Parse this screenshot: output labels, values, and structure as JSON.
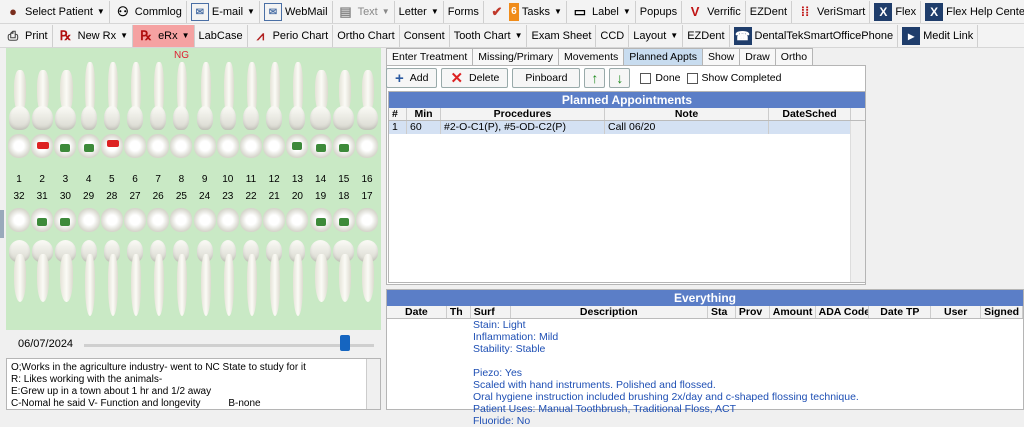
{
  "toolbar1": [
    {
      "label": "Select Patient",
      "icon": "patient-icon",
      "dropdown": true
    },
    {
      "label": "Commlog",
      "icon": "commlog-icon"
    },
    {
      "label": "E-mail",
      "icon": "email-icon",
      "dropdown": true
    },
    {
      "label": "WebMail",
      "icon": "webmail-icon"
    },
    {
      "label": "Text",
      "icon": "text-message-icon",
      "dropdown": true,
      "disabled": true
    },
    {
      "label": "Letter",
      "dropdown": true
    },
    {
      "label": "Forms"
    },
    {
      "label": "Tasks",
      "icon": "tasks-icon",
      "badge": "6",
      "dropdown": true
    },
    {
      "label": "Label",
      "icon": "label-icon",
      "dropdown": true
    },
    {
      "label": "Popups"
    },
    {
      "label": "Verrific",
      "icon": "verrific-icon"
    },
    {
      "label": "EZDent"
    },
    {
      "label": "VeriSmart",
      "icon": "verismart-icon"
    },
    {
      "label": "Flex",
      "icon": "flex-icon"
    },
    {
      "label": "Flex Help Center",
      "icon": "flex-help-icon"
    }
  ],
  "toolbar2": [
    {
      "label": "Print",
      "icon": "print-icon"
    },
    {
      "label": "New Rx",
      "icon": "rx-icon",
      "dropdown": true
    },
    {
      "label": "eRx",
      "icon": "erx-icon",
      "dropdown": true,
      "highlight": true
    },
    {
      "label": "LabCase"
    },
    {
      "label": "Perio Chart",
      "icon": "perio-chart-icon"
    },
    {
      "label": "Ortho Chart"
    },
    {
      "label": "Consent"
    },
    {
      "label": "Tooth Chart",
      "dropdown": true
    },
    {
      "label": "Exam Sheet"
    },
    {
      "label": "CCD"
    },
    {
      "label": "Layout",
      "dropdown": true
    },
    {
      "label": "EZDent"
    },
    {
      "label": "DentalTekSmartOfficePhone",
      "icon": "phone-icon"
    },
    {
      "label": "Medit Link",
      "icon": "medit-link-icon"
    }
  ],
  "chart": {
    "ng_label": "NG",
    "upper_numbers": [
      "1",
      "2",
      "3",
      "4",
      "5",
      "6",
      "7",
      "8",
      "9",
      "10",
      "11",
      "12",
      "13",
      "14",
      "15",
      "16"
    ],
    "lower_numbers": [
      "32",
      "31",
      "30",
      "29",
      "28",
      "27",
      "26",
      "25",
      "24",
      "23",
      "22",
      "21",
      "20",
      "19",
      "18",
      "17"
    ]
  },
  "date": {
    "label": "06/07/2024",
    "slider_value": 0.9
  },
  "notes": [
    "O;Works in the agriculture industry- went to NC State to study for it",
    "R: Likes working with the animals-",
    "E:Grew up in a town about 1 hr and 1/2 away",
    "C-Nomal he said V- Function and longevity          B-none"
  ],
  "tabs": [
    {
      "label": "Enter Treatment"
    },
    {
      "label": "Missing/Primary"
    },
    {
      "label": "Movements"
    },
    {
      "label": "Planned Appts",
      "active": true
    },
    {
      "label": "Show"
    },
    {
      "label": "Draw"
    },
    {
      "label": "Ortho"
    }
  ],
  "actions": {
    "add": "Add",
    "delete": "Delete",
    "pinboard": "Pinboard",
    "done": "Done",
    "show_completed": "Show Completed"
  },
  "planned": {
    "title": "Planned Appointments",
    "columns": [
      "#",
      "Min",
      "Procedures",
      "Note",
      "DateSched"
    ],
    "rows": [
      [
        "1",
        "60",
        "#2-O-C1(P), #5-OD-C2(P)",
        "Call 06/20",
        ""
      ]
    ]
  },
  "everything": {
    "title": "Everything",
    "columns": [
      "Date",
      "Th",
      "Surf",
      "Description",
      "Sta",
      "Prov",
      "Amount",
      "ADA Code",
      "Date TP",
      "User",
      "Signed"
    ],
    "lines": [
      "Stain: Light",
      "Inflammation: Mild",
      "Stability: Stable",
      "",
      "Piezo: Yes",
      "Scaled with hand instruments. Polished and flossed.",
      "Oral hygiene instruction included brushing 2x/day and c-shaped flossing technique.",
      "Patient Uses: Manual Toothbrush, Traditional Floss, ACT",
      "Fluoride: No"
    ]
  },
  "colors": {
    "chart_bg": "#c9e9c5",
    "grid_title": "#5b7ec7",
    "progress_note": "#1e4fb4",
    "erx": "#f5a2a2"
  }
}
